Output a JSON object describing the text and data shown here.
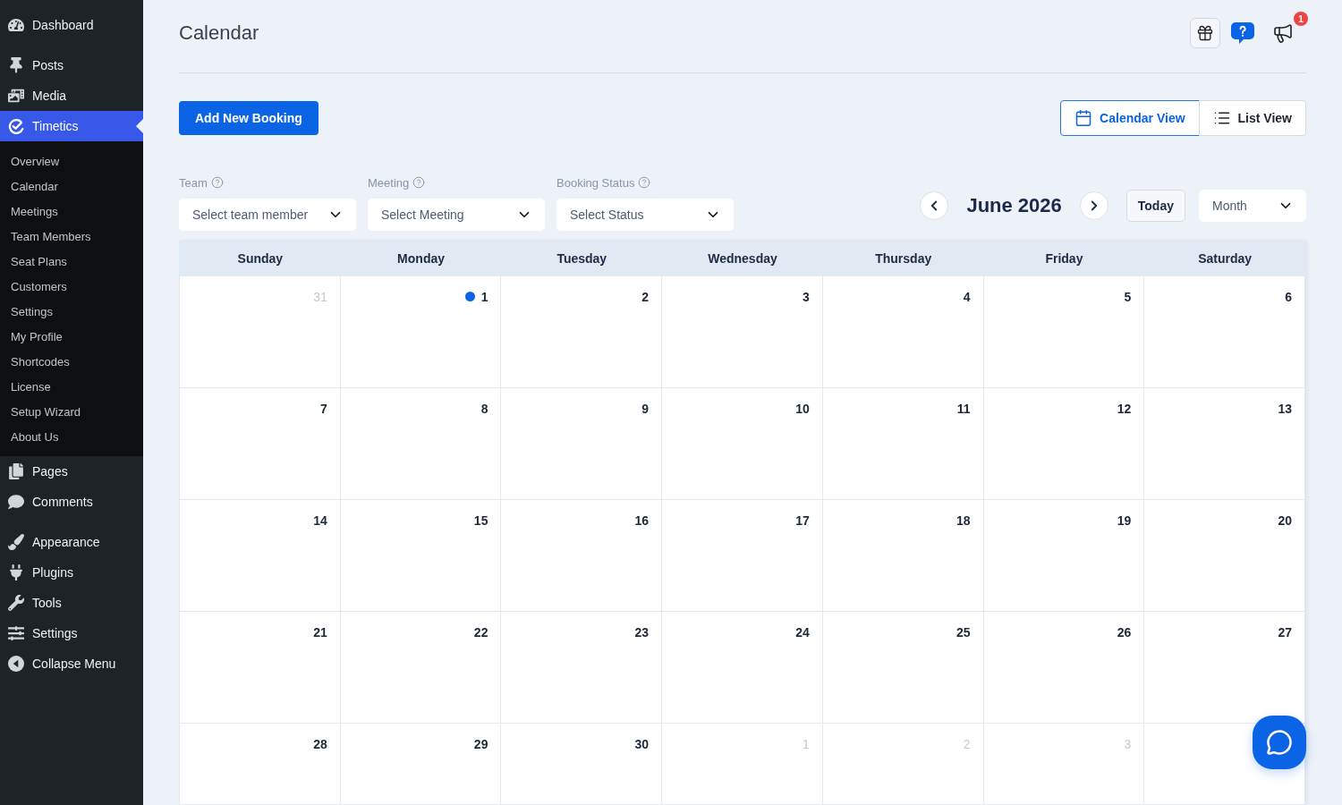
{
  "sidebar": {
    "groups": [
      {
        "items": [
          {
            "label": "Dashboard",
            "selected": false
          }
        ]
      },
      {
        "items": [
          {
            "label": "Posts",
            "selected": false
          },
          {
            "label": "Media",
            "selected": false
          },
          {
            "label": "Timetics",
            "selected": true,
            "children": [
              {
                "label": "Overview",
                "selected": false
              },
              {
                "label": "Calendar",
                "selected": false
              },
              {
                "label": "Meetings",
                "selected": false
              },
              {
                "label": "Team Members",
                "selected": false
              },
              {
                "label": "Seat Plans",
                "selected": false
              },
              {
                "label": "Customers",
                "selected": false
              },
              {
                "label": "Settings",
                "selected": false
              },
              {
                "label": "My Profile",
                "selected": false
              },
              {
                "label": "Shortcodes",
                "selected": false
              },
              {
                "label": "License",
                "selected": false
              },
              {
                "label": "Setup Wizard",
                "selected": false
              },
              {
                "label": "About Us",
                "selected": false
              }
            ]
          },
          {
            "label": "Pages",
            "selected": false
          },
          {
            "label": "Comments",
            "selected": false
          }
        ]
      },
      {
        "items": [
          {
            "label": "Appearance",
            "selected": false
          },
          {
            "label": "Plugins",
            "selected": false
          },
          {
            "label": "Tools",
            "selected": false
          },
          {
            "label": "Settings",
            "selected": false
          },
          {
            "label": "Collapse Menu",
            "selected": false
          }
        ]
      }
    ]
  },
  "header": {
    "title": "Calendar",
    "notification_count": "1"
  },
  "toolbar": {
    "add_button": "Add New Booking",
    "views": [
      {
        "label": "Calendar View",
        "selected": true
      },
      {
        "label": "List View",
        "selected": false
      }
    ]
  },
  "filters": [
    {
      "label": "Team",
      "placeholder": "Select team member"
    },
    {
      "label": "Meeting",
      "placeholder": "Select Meeting"
    },
    {
      "label": "Booking Status",
      "placeholder": "Select Status"
    }
  ],
  "navigation": {
    "month_label": "June 2026",
    "today_button": "Today",
    "range_select": {
      "value": "Month"
    }
  },
  "calendar": {
    "weekdays": [
      "Sunday",
      "Monday",
      "Tuesday",
      "Wednesday",
      "Thursday",
      "Friday",
      "Saturday"
    ],
    "weeks": [
      [
        {
          "date": "31",
          "muted": true,
          "event": false
        },
        {
          "date": "1",
          "muted": false,
          "event": true
        },
        {
          "date": "2",
          "muted": false,
          "event": false
        },
        {
          "date": "3",
          "muted": false,
          "event": false
        },
        {
          "date": "4",
          "muted": false,
          "event": false
        },
        {
          "date": "5",
          "muted": false,
          "event": false
        },
        {
          "date": "6",
          "muted": false,
          "event": false
        }
      ],
      [
        {
          "date": "7",
          "muted": false,
          "event": false
        },
        {
          "date": "8",
          "muted": false,
          "event": false
        },
        {
          "date": "9",
          "muted": false,
          "event": false
        },
        {
          "date": "10",
          "muted": false,
          "event": false
        },
        {
          "date": "11",
          "muted": false,
          "event": false
        },
        {
          "date": "12",
          "muted": false,
          "event": false
        },
        {
          "date": "13",
          "muted": false,
          "event": false
        }
      ],
      [
        {
          "date": "14",
          "muted": false,
          "event": false
        },
        {
          "date": "15",
          "muted": false,
          "event": false
        },
        {
          "date": "16",
          "muted": false,
          "event": false
        },
        {
          "date": "17",
          "muted": false,
          "event": false
        },
        {
          "date": "18",
          "muted": false,
          "event": false
        },
        {
          "date": "19",
          "muted": false,
          "event": false
        },
        {
          "date": "20",
          "muted": false,
          "event": false
        }
      ],
      [
        {
          "date": "21",
          "muted": false,
          "event": false
        },
        {
          "date": "22",
          "muted": false,
          "event": false
        },
        {
          "date": "23",
          "muted": false,
          "event": false
        },
        {
          "date": "24",
          "muted": false,
          "event": false
        },
        {
          "date": "25",
          "muted": false,
          "event": false
        },
        {
          "date": "26",
          "muted": false,
          "event": false
        },
        {
          "date": "27",
          "muted": false,
          "event": false
        }
      ],
      [
        {
          "date": "28",
          "muted": false,
          "event": false
        },
        {
          "date": "29",
          "muted": false,
          "event": false
        },
        {
          "date": "30",
          "muted": false,
          "event": false
        },
        {
          "date": "1",
          "muted": true,
          "event": false
        },
        {
          "date": "2",
          "muted": true,
          "event": false
        },
        {
          "date": "3",
          "muted": true,
          "event": false
        }
      ]
    ]
  }
}
